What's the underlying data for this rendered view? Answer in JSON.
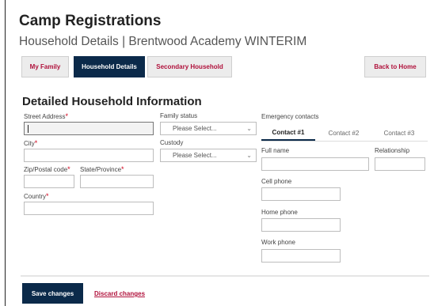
{
  "header": {
    "title": "Camp Registrations",
    "subtitle": "Household Details | Brentwood Academy WINTERIM"
  },
  "nav": {
    "tabs": [
      {
        "label": "My Family",
        "active": false
      },
      {
        "label": "Household Details",
        "active": true
      },
      {
        "label": "Secondary Household",
        "active": false
      }
    ],
    "back_label": "Back to Home"
  },
  "section": {
    "title": "Detailed Household Information"
  },
  "form": {
    "street_label": "Street Address",
    "street_value": "",
    "city_label": "City",
    "zip_label": "Zip/Postal code",
    "state_label": "State/Province",
    "country_label": "Country",
    "required_mark": "*",
    "family_status_label": "Family status",
    "family_status_value": "Please Select...",
    "custody_label": "Custody",
    "custody_value": "Please Select..."
  },
  "emergency": {
    "title": "Emergency contacts",
    "tabs": [
      {
        "label": "Contact #1",
        "active": true
      },
      {
        "label": "Contact #2",
        "active": false
      },
      {
        "label": "Contact #3",
        "active": false
      }
    ],
    "full_name_label": "Full name",
    "relationship_label": "Relationship",
    "cell_label": "Cell phone",
    "home_label": "Home phone",
    "work_label": "Work phone"
  },
  "footer": {
    "save_label": "Save changes",
    "discard_label": "Discard changes"
  },
  "colors": {
    "navy": "#0b2a4a",
    "accent_red": "#b0113b",
    "required_red": "#d0021b"
  },
  "icons": [
    "chevron-down-icon"
  ]
}
